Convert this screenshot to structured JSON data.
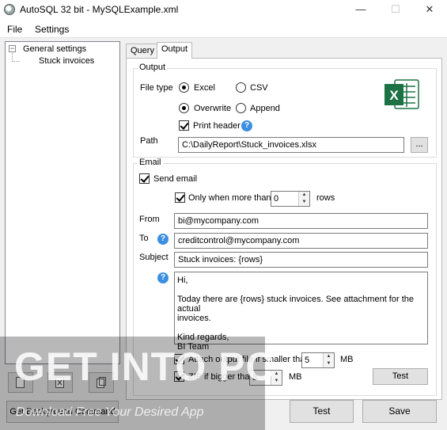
{
  "window": {
    "title": "AutoSQL 32 bit - MySQLExample.xml",
    "minimize": "—",
    "maximize": "☐",
    "close": "✕"
  },
  "menu": [
    "File",
    "Settings"
  ],
  "tree": {
    "root": "General settings",
    "child": "Stuck invoices",
    "toggle": "−"
  },
  "tabs": [
    "Query",
    "Output"
  ],
  "output": {
    "group_title": "Output",
    "file_type_label": "File type",
    "excel": "Excel",
    "csv": "CSV",
    "overwrite": "Overwrite",
    "append": "Append",
    "print_header": "Print header",
    "path_label": "Path",
    "path_value": "C:\\DailyReport\\Stuck_invoices.xlsx",
    "browse": "..."
  },
  "email": {
    "group_title": "Email",
    "send_email": "Send email",
    "only_when": "Only when more than",
    "only_when_value": "0",
    "rows": "rows",
    "from_label": "From",
    "from_value": "bi@mycompany.com",
    "to_label": "To",
    "to_value": "creditcontrol@mycompany.com",
    "subject_label": "Subject",
    "subject_value": "Stuck invoices: {rows}",
    "body": {
      "l1": "Hi,",
      "l2": "",
      "l3": "Today there are {rows} stuck invoices. See attachment for the actual",
      "l4": "invoices.",
      "l5": "",
      "l6": "Kind regards,",
      "l7": "BI Team"
    },
    "attach": "Attach output file if smaller than",
    "attach_value": "5",
    "mb": "MB",
    "zip": "ZIP if bigger than",
    "zip_value": "3",
    "mb2": "MB",
    "test_email": "Test"
  },
  "bottom": {
    "get_background": "Get Background Command",
    "test": "Test",
    "save": "Save"
  },
  "watermark": {
    "big": "GET INTO PC",
    "small": "Download Free Your Desired App"
  },
  "colors": {
    "excel_green": "#1d7245",
    "help_blue": "#3c8fe0"
  }
}
